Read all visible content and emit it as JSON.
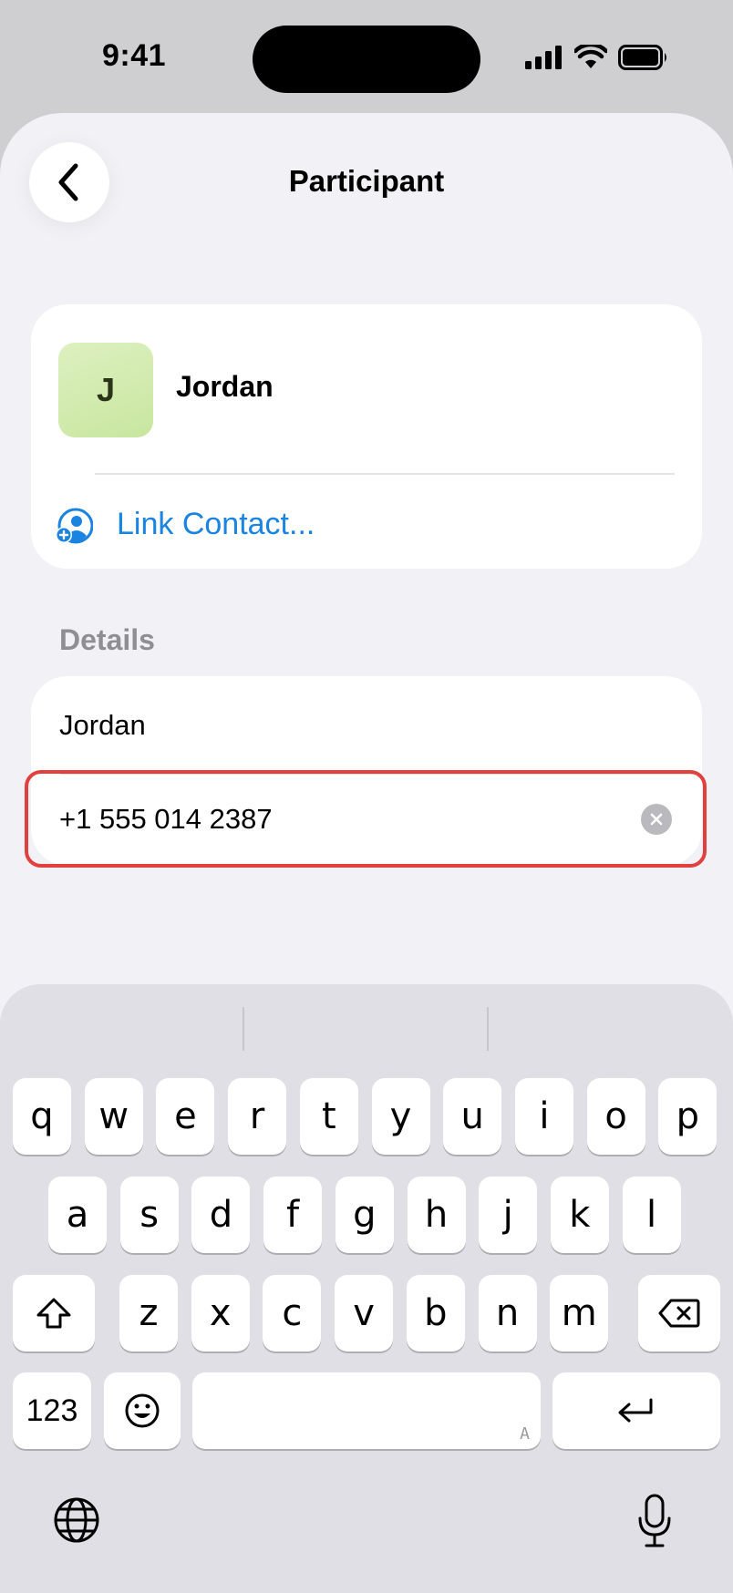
{
  "status_bar": {
    "time": "9:41"
  },
  "nav": {
    "title": "Participant",
    "back_icon": "chevron-left-icon"
  },
  "participant": {
    "initial": "J",
    "name": "Jordan",
    "link_contact_label": "Link Contact..."
  },
  "details": {
    "section_label": "Details",
    "name_value": "Jordan",
    "phone_value": "+1 555 014 2387"
  },
  "keyboard": {
    "row1": [
      "q",
      "w",
      "e",
      "r",
      "t",
      "y",
      "u",
      "i",
      "o",
      "p"
    ],
    "row2": [
      "a",
      "s",
      "d",
      "f",
      "g",
      "h",
      "j",
      "k",
      "l"
    ],
    "row3": [
      "z",
      "x",
      "c",
      "v",
      "b",
      "n",
      "m"
    ],
    "numbers_label": "123",
    "space_hint": "A"
  },
  "colors": {
    "accent": "#1a84e0",
    "highlight": "#e1413e",
    "avatar_bg": "#d4ebb0",
    "sheet_bg": "#f1f1f6",
    "keyboard_bg": "#dfdfe5"
  }
}
